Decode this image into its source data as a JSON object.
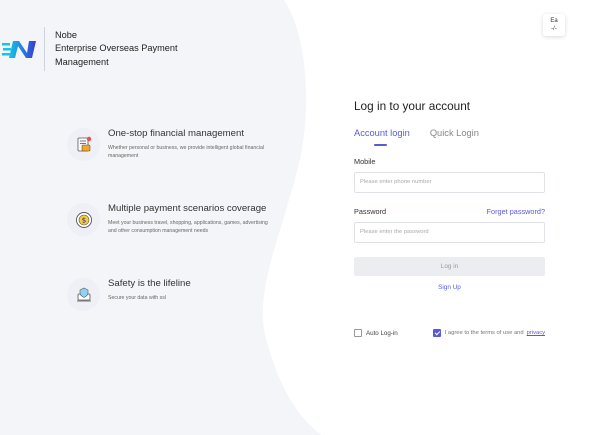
{
  "brand": {
    "line1": "Nobe",
    "line2": "Enterprise Overseas Payment",
    "line3": "Management",
    "colors": {
      "logo_start": "#16c4e8",
      "logo_end": "#3a3ad0"
    }
  },
  "language_toggle": {
    "label_top": "Ea",
    "label_bottom": "-/-"
  },
  "features": [
    {
      "title": "One-stop financial management",
      "desc": "Whether personal or business, we provide intelligent global financial management",
      "icon": "document-card-icon"
    },
    {
      "title": "Multiple payment scenarios coverage",
      "desc": "Meet your business travel, shopping, applications, games, advertising and other consumption management needs",
      "icon": "dollar-coin-icon"
    },
    {
      "title": "Safety is the lifeline",
      "desc": "Secure your data with ssl",
      "icon": "shield-laptop-icon"
    }
  ],
  "login": {
    "title": "Log in to your account",
    "tabs": [
      {
        "label": "Account login",
        "active": true
      },
      {
        "label": "Quick Login",
        "active": false
      }
    ],
    "mobile_label": "Mobile",
    "mobile_placeholder": "Please enter phone number",
    "password_label": "Password",
    "forgot_label": "Forget password?",
    "password_placeholder": "Please enter the password",
    "login_button": "Log in",
    "signup_link": "Sign Up",
    "auto_login_label": "Auto Log-in",
    "auto_login_checked": false,
    "terms_label": "I agree to the terms of use and",
    "terms_checked": true,
    "privacy_link": "privacy"
  },
  "colors": {
    "accent": "#5a5ad6",
    "panel_bg": "#f4f5f8",
    "button_disabled": "#ecedf1"
  }
}
